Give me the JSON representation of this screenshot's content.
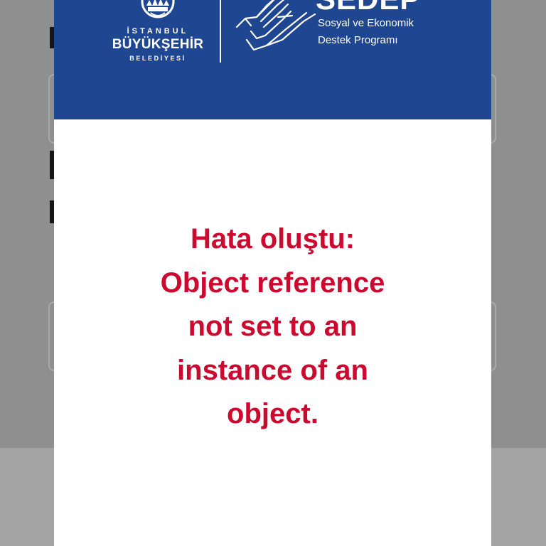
{
  "background": {
    "overlay_color": "#8f8f8f"
  },
  "header": {
    "background_color": "#1f4691",
    "logo": {
      "line1": "İSTANBUL",
      "line2": "BÜYÜKŞEHİR",
      "line3": "BELEDİYESİ"
    },
    "program": {
      "title": "SEDEP",
      "subtitle_line1": "Sosyal ve Ekonomik",
      "subtitle_line2": "Destek Programı"
    }
  },
  "error": {
    "message": "Hata oluştu: Object reference not set to an instance of an object.",
    "color": "#cc0a2f"
  }
}
